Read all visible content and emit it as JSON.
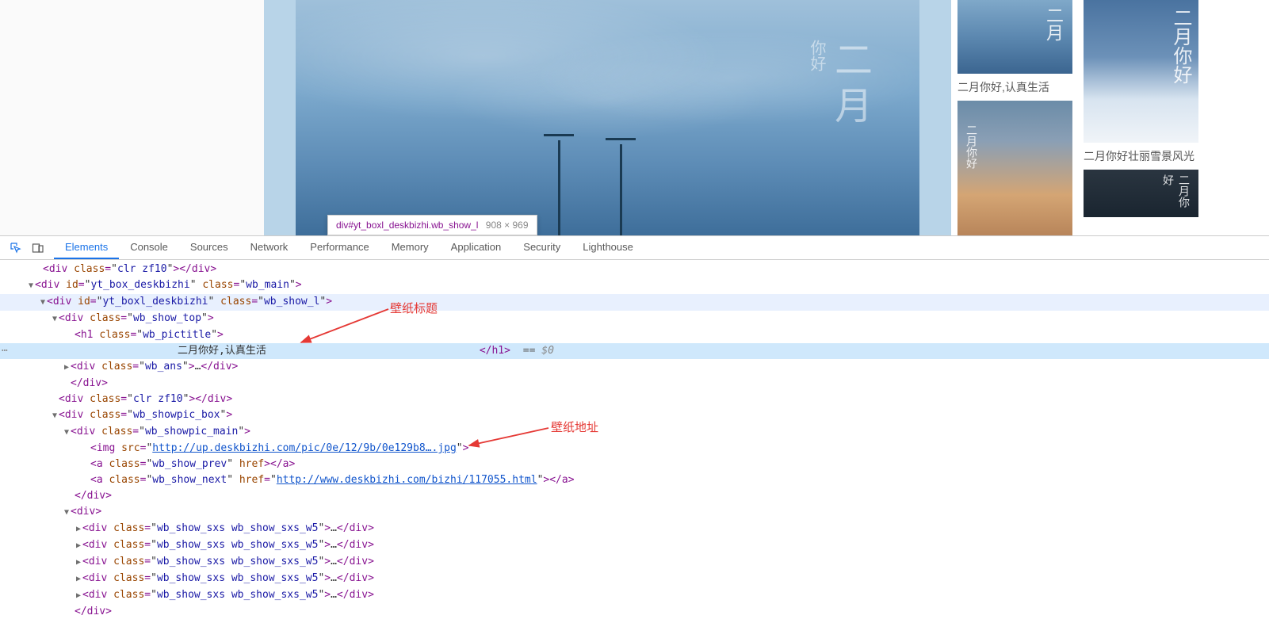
{
  "dim_tooltip": {
    "selector": "div#yt_boxl_deskbizhi.wb_show_l",
    "dims": "908 × 969"
  },
  "main_image": {
    "text_small": "你好",
    "text_large": "二月"
  },
  "thumbs": [
    {
      "overlay_right": "二月",
      "label": "二月你好,认真生活"
    },
    {
      "overlay_left": "二月你好",
      "label": ""
    },
    {
      "overlay_right": "二月你好",
      "label": "二月你好壮丽雪景风光"
    },
    {
      "overlay_right": "二月你好",
      "label": ""
    }
  ],
  "devtools": {
    "tabs": [
      "Elements",
      "Console",
      "Sources",
      "Network",
      "Performance",
      "Memory",
      "Application",
      "Security",
      "Lighthouse"
    ],
    "active_tab": "Elements"
  },
  "annotations": {
    "title": "壁纸标题",
    "url": "壁纸地址"
  },
  "dom": {
    "l1": {
      "indent": 40,
      "caret": "none",
      "html": "<div class=\"clr zf10\"></div>"
    },
    "l2": {
      "indent": 30,
      "caret": "open",
      "html": "<div id=\"yt_box_deskbizhi\" class=\"wb_main\">"
    },
    "l3": {
      "indent": 45,
      "caret": "open",
      "html": "<div id=\"yt_boxl_deskbizhi\" class=\"wb_show_l\">",
      "highlight": true
    },
    "l4": {
      "indent": 60,
      "caret": "open",
      "html": "<div class=\"wb_show_top\">"
    },
    "l5": {
      "indent": 80,
      "caret": "none",
      "html": "<h1 class=\"wb_pictitle\">"
    },
    "l6": {
      "indent": 210,
      "caret": "none",
      "text": "二月你好,认真生活",
      "close": "</h1>",
      "close_indent": 560,
      "eq": " == $0",
      "selected": true,
      "ellipsis": true
    },
    "l7": {
      "indent": 75,
      "caret": "closed",
      "html": "<div class=\"wb_ans\">…</div>"
    },
    "l8": {
      "indent": 75,
      "caret": "none",
      "html": "</div>"
    },
    "l9": {
      "indent": 60,
      "caret": "none",
      "html": "<div class=\"clr zf10\"></div>"
    },
    "l10": {
      "indent": 60,
      "caret": "open",
      "html": "<div class=\"wb_showpic_box\">"
    },
    "l11": {
      "indent": 75,
      "caret": "open",
      "html": "<div class=\"wb_showpic_main\">"
    },
    "l12": {
      "indent": 100,
      "caret": "none",
      "img_src": "http://up.deskbizhi.com/pic/0e/12/9b/0e129b8….jpg"
    },
    "l13": {
      "indent": 100,
      "caret": "none",
      "a_class": "wb_show_prev",
      "a_href_empty": true
    },
    "l14": {
      "indent": 100,
      "caret": "none",
      "a_class": "wb_show_next",
      "a_href": "http://www.deskbizhi.com/bizhi/117055.html"
    },
    "l15": {
      "indent": 80,
      "caret": "none",
      "html": "</div>"
    },
    "l16": {
      "indent": 75,
      "caret": "open",
      "html": "<div>"
    },
    "l17": {
      "indent": 90,
      "caret": "closed",
      "html": "<div class=\"wb_show_sxs wb_show_sxs_w5\">…</div>"
    },
    "l18": {
      "indent": 90,
      "caret": "closed",
      "html": "<div class=\"wb_show_sxs wb_show_sxs_w5\">…</div>"
    },
    "l19": {
      "indent": 90,
      "caret": "closed",
      "html": "<div class=\"wb_show_sxs wb_show_sxs_w5\">…</div>"
    },
    "l20": {
      "indent": 90,
      "caret": "closed",
      "html": "<div class=\"wb_show_sxs wb_show_sxs_w5\">…</div>"
    },
    "l21": {
      "indent": 90,
      "caret": "closed",
      "html": "<div class=\"wb_show_sxs wb_show_sxs_w5\">…</div>"
    },
    "l22": {
      "indent": 80,
      "caret": "none",
      "html": "</div>"
    }
  }
}
